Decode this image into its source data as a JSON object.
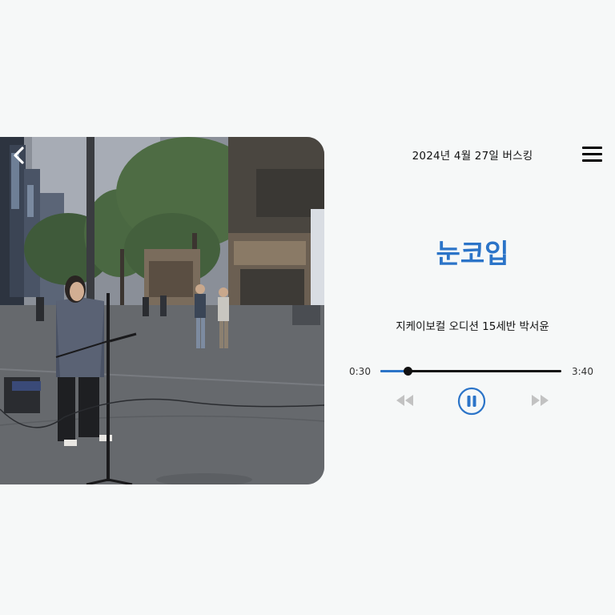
{
  "header": {
    "event_title": "2024년 4월 27일 버스킹"
  },
  "track": {
    "title": "눈코입",
    "artist": "지케이보컬 오디션 15세반 박서윤"
  },
  "player": {
    "current_time": "0:30",
    "total_time": "3:40",
    "progress_fraction": 0.153,
    "state": "playing"
  },
  "icons": {
    "back": "chevron-left-icon",
    "menu": "hamburger-menu-icon",
    "rewind": "rewind-icon",
    "pause": "pause-icon",
    "forward": "fast-forward-icon"
  },
  "colors": {
    "accent": "#2b74c8",
    "background": "#f6f8f8",
    "disabled_control": "#c2c2c2"
  }
}
